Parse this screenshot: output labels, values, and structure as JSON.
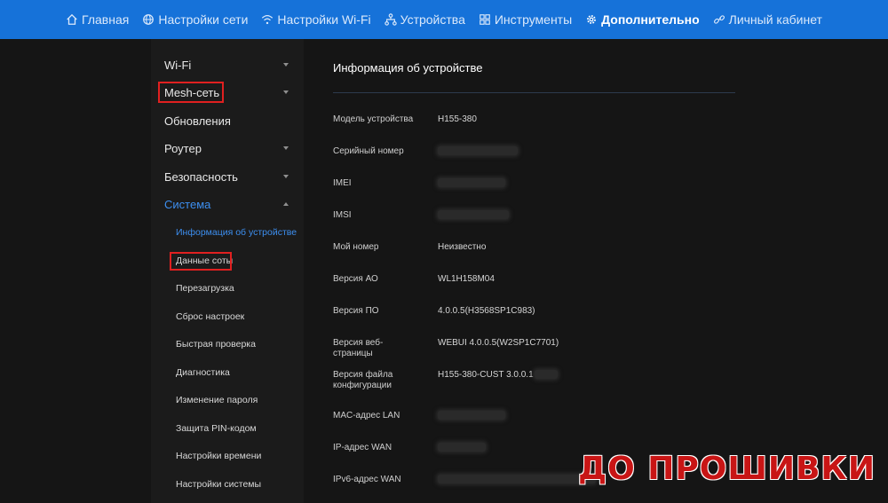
{
  "nav": [
    {
      "label": "Главная",
      "icon": "home-icon"
    },
    {
      "label": "Настройки сети",
      "icon": "globe-icon"
    },
    {
      "label": "Настройки Wi-Fi",
      "icon": "wifi-icon"
    },
    {
      "label": "Устройства",
      "icon": "devices-icon"
    },
    {
      "label": "Инструменты",
      "icon": "tools-grid-icon"
    },
    {
      "label": "Дополнительно",
      "icon": "gear-icon",
      "active": true
    },
    {
      "label": "Личный кабинет",
      "icon": "link-icon"
    }
  ],
  "sidebar": {
    "items": [
      {
        "label": "Wi-Fi"
      },
      {
        "label": "Mesh-сеть"
      },
      {
        "label": "Обновления"
      },
      {
        "label": "Роутер"
      },
      {
        "label": "Безопасность"
      },
      {
        "label": "Система"
      }
    ],
    "sub_items": [
      {
        "label": "Информация об устройстве"
      },
      {
        "label": "Данные соты"
      },
      {
        "label": "Перезагрузка"
      },
      {
        "label": "Сброс настроек"
      },
      {
        "label": "Быстрая проверка"
      },
      {
        "label": "Диагностика"
      },
      {
        "label": "Изменение пароля"
      },
      {
        "label": "Защита PIN-кодом"
      },
      {
        "label": "Настройки времени"
      },
      {
        "label": "Настройки системы"
      }
    ]
  },
  "main": {
    "title": "Информация об устройстве",
    "rows": [
      {
        "label": "Модель устройства",
        "value": "H155-380"
      },
      {
        "label": "Серийный номер",
        "value": ""
      },
      {
        "label": "IMEI",
        "value": ""
      },
      {
        "label": "IMSI",
        "value": ""
      },
      {
        "label": "Мой номер",
        "value": "Неизвестно"
      },
      {
        "label": "Версия АО",
        "value": "WL1H158M04"
      },
      {
        "label": "Версия ПО",
        "value": "4.0.0.5(H3568SP1C983)"
      },
      {
        "label": "Версия веб-страницы",
        "value": "WEBUI 4.0.0.5(W2SP1C7701)"
      },
      {
        "label": "Версия файла конфигурации",
        "value": "H155-380-CUST 3.0.0.1"
      },
      {
        "label": "MAC-адрес LAN",
        "value": ""
      },
      {
        "label": "IP-адрес WAN",
        "value": ""
      },
      {
        "label": "IPv6-адрес WAN",
        "value": ""
      }
    ]
  },
  "watermark": "ДО ПРОШИВКИ",
  "colors": {
    "accent": "#1672d9",
    "highlight": "#e02020",
    "selected": "#3d8ff0"
  }
}
